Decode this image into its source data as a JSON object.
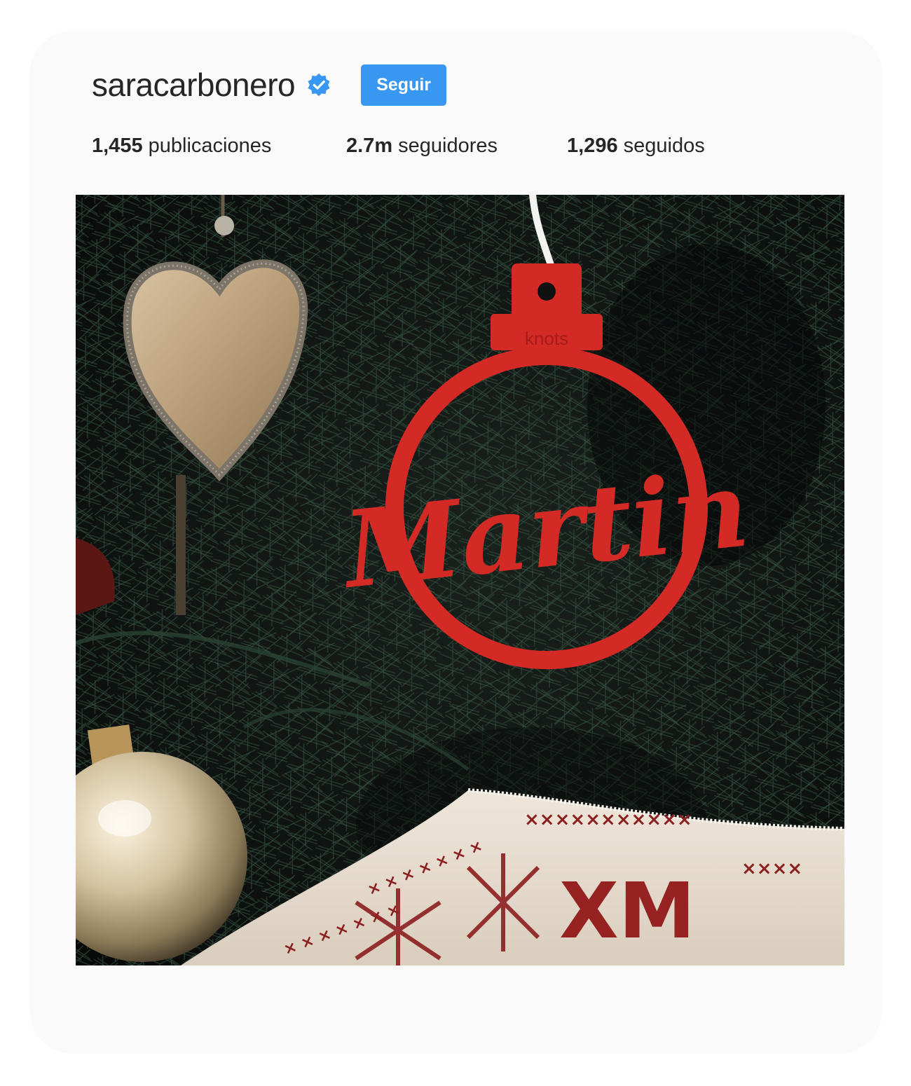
{
  "profile": {
    "username": "saracarbonero",
    "verified_icon": "verified-badge-icon",
    "follow_label": "Seguir",
    "accent_color": "#3897f0"
  },
  "stats": {
    "posts_count": "1,455",
    "posts_label": "publicaciones",
    "followers_count": "2.7m",
    "followers_label": "seguidores",
    "following_count": "1,296",
    "following_label": "seguidos"
  },
  "post": {
    "ornament_name": "Martin",
    "ornament_brand": "knots",
    "ornament_color": "#d42a25"
  }
}
